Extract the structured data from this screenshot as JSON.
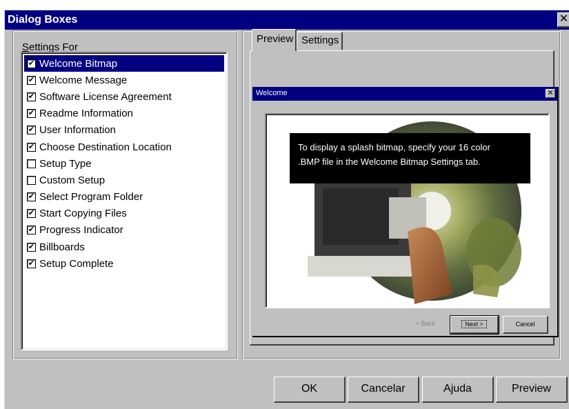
{
  "window": {
    "title": "Dialog Boxes",
    "close_glyph": "✕"
  },
  "settings": {
    "label_prefix": "S",
    "label_rest": "ettings For",
    "items": [
      {
        "label": "Welcome Bitmap",
        "checked": true,
        "selected": true
      },
      {
        "label": "Welcome Message",
        "checked": true,
        "selected": false
      },
      {
        "label": "Software License Agreement",
        "checked": true,
        "selected": false
      },
      {
        "label": "Readme Information",
        "checked": true,
        "selected": false
      },
      {
        "label": "User Information",
        "checked": true,
        "selected": false
      },
      {
        "label": "Choose Destination Location",
        "checked": true,
        "selected": false
      },
      {
        "label": "Setup Type",
        "checked": false,
        "selected": false
      },
      {
        "label": "Custom Setup",
        "checked": false,
        "selected": false
      },
      {
        "label": "Select Program Folder",
        "checked": true,
        "selected": false
      },
      {
        "label": "Start Copying Files",
        "checked": true,
        "selected": false
      },
      {
        "label": "Progress Indicator",
        "checked": true,
        "selected": false
      },
      {
        "label": "Billboards",
        "checked": true,
        "selected": false
      },
      {
        "label": "Setup Complete",
        "checked": true,
        "selected": false
      }
    ]
  },
  "tabs": {
    "preview": "Preview",
    "settings": "Settings",
    "active": "preview"
  },
  "preview": {
    "window_title": "Welcome",
    "close_glyph": "✕",
    "tip_line1": "To display a splash bitmap, specify your 16 color",
    "tip_line2": ".BMP file in the Welcome Bitmap Settings tab.",
    "back": "< Back",
    "next": "Next >",
    "cancel": "Cancel"
  },
  "buttons": {
    "ok": "OK",
    "cancel": "Cancelar",
    "help": "Ajuda",
    "preview": "Preview"
  },
  "colors": {
    "titlebar": "#000080",
    "face": "#c0c0c0",
    "selection": "#000080"
  }
}
